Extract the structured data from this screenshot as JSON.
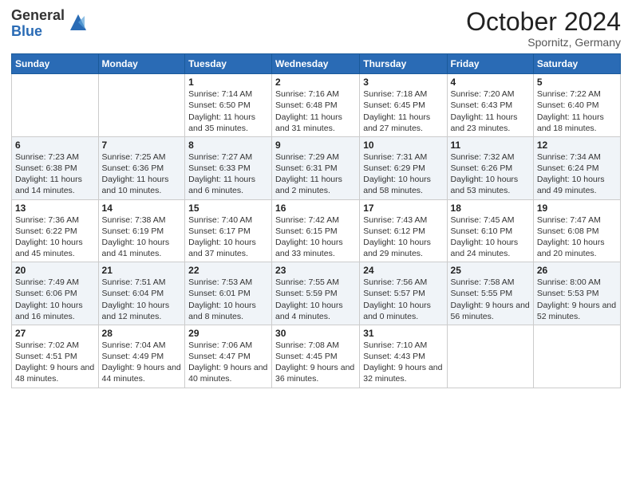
{
  "logo": {
    "general": "General",
    "blue": "Blue"
  },
  "header": {
    "month": "October 2024",
    "location": "Spornitz, Germany"
  },
  "weekdays": [
    "Sunday",
    "Monday",
    "Tuesday",
    "Wednesday",
    "Thursday",
    "Friday",
    "Saturday"
  ],
  "weeks": [
    [
      {
        "day": "",
        "info": ""
      },
      {
        "day": "",
        "info": ""
      },
      {
        "day": "1",
        "info": "Sunrise: 7:14 AM\nSunset: 6:50 PM\nDaylight: 11 hours and 35 minutes."
      },
      {
        "day": "2",
        "info": "Sunrise: 7:16 AM\nSunset: 6:48 PM\nDaylight: 11 hours and 31 minutes."
      },
      {
        "day": "3",
        "info": "Sunrise: 7:18 AM\nSunset: 6:45 PM\nDaylight: 11 hours and 27 minutes."
      },
      {
        "day": "4",
        "info": "Sunrise: 7:20 AM\nSunset: 6:43 PM\nDaylight: 11 hours and 23 minutes."
      },
      {
        "day": "5",
        "info": "Sunrise: 7:22 AM\nSunset: 6:40 PM\nDaylight: 11 hours and 18 minutes."
      }
    ],
    [
      {
        "day": "6",
        "info": "Sunrise: 7:23 AM\nSunset: 6:38 PM\nDaylight: 11 hours and 14 minutes."
      },
      {
        "day": "7",
        "info": "Sunrise: 7:25 AM\nSunset: 6:36 PM\nDaylight: 11 hours and 10 minutes."
      },
      {
        "day": "8",
        "info": "Sunrise: 7:27 AM\nSunset: 6:33 PM\nDaylight: 11 hours and 6 minutes."
      },
      {
        "day": "9",
        "info": "Sunrise: 7:29 AM\nSunset: 6:31 PM\nDaylight: 11 hours and 2 minutes."
      },
      {
        "day": "10",
        "info": "Sunrise: 7:31 AM\nSunset: 6:29 PM\nDaylight: 10 hours and 58 minutes."
      },
      {
        "day": "11",
        "info": "Sunrise: 7:32 AM\nSunset: 6:26 PM\nDaylight: 10 hours and 53 minutes."
      },
      {
        "day": "12",
        "info": "Sunrise: 7:34 AM\nSunset: 6:24 PM\nDaylight: 10 hours and 49 minutes."
      }
    ],
    [
      {
        "day": "13",
        "info": "Sunrise: 7:36 AM\nSunset: 6:22 PM\nDaylight: 10 hours and 45 minutes."
      },
      {
        "day": "14",
        "info": "Sunrise: 7:38 AM\nSunset: 6:19 PM\nDaylight: 10 hours and 41 minutes."
      },
      {
        "day": "15",
        "info": "Sunrise: 7:40 AM\nSunset: 6:17 PM\nDaylight: 10 hours and 37 minutes."
      },
      {
        "day": "16",
        "info": "Sunrise: 7:42 AM\nSunset: 6:15 PM\nDaylight: 10 hours and 33 minutes."
      },
      {
        "day": "17",
        "info": "Sunrise: 7:43 AM\nSunset: 6:12 PM\nDaylight: 10 hours and 29 minutes."
      },
      {
        "day": "18",
        "info": "Sunrise: 7:45 AM\nSunset: 6:10 PM\nDaylight: 10 hours and 24 minutes."
      },
      {
        "day": "19",
        "info": "Sunrise: 7:47 AM\nSunset: 6:08 PM\nDaylight: 10 hours and 20 minutes."
      }
    ],
    [
      {
        "day": "20",
        "info": "Sunrise: 7:49 AM\nSunset: 6:06 PM\nDaylight: 10 hours and 16 minutes."
      },
      {
        "day": "21",
        "info": "Sunrise: 7:51 AM\nSunset: 6:04 PM\nDaylight: 10 hours and 12 minutes."
      },
      {
        "day": "22",
        "info": "Sunrise: 7:53 AM\nSunset: 6:01 PM\nDaylight: 10 hours and 8 minutes."
      },
      {
        "day": "23",
        "info": "Sunrise: 7:55 AM\nSunset: 5:59 PM\nDaylight: 10 hours and 4 minutes."
      },
      {
        "day": "24",
        "info": "Sunrise: 7:56 AM\nSunset: 5:57 PM\nDaylight: 10 hours and 0 minutes."
      },
      {
        "day": "25",
        "info": "Sunrise: 7:58 AM\nSunset: 5:55 PM\nDaylight: 9 hours and 56 minutes."
      },
      {
        "day": "26",
        "info": "Sunrise: 8:00 AM\nSunset: 5:53 PM\nDaylight: 9 hours and 52 minutes."
      }
    ],
    [
      {
        "day": "27",
        "info": "Sunrise: 7:02 AM\nSunset: 4:51 PM\nDaylight: 9 hours and 48 minutes."
      },
      {
        "day": "28",
        "info": "Sunrise: 7:04 AM\nSunset: 4:49 PM\nDaylight: 9 hours and 44 minutes."
      },
      {
        "day": "29",
        "info": "Sunrise: 7:06 AM\nSunset: 4:47 PM\nDaylight: 9 hours and 40 minutes."
      },
      {
        "day": "30",
        "info": "Sunrise: 7:08 AM\nSunset: 4:45 PM\nDaylight: 9 hours and 36 minutes."
      },
      {
        "day": "31",
        "info": "Sunrise: 7:10 AM\nSunset: 4:43 PM\nDaylight: 9 hours and 32 minutes."
      },
      {
        "day": "",
        "info": ""
      },
      {
        "day": "",
        "info": ""
      }
    ]
  ]
}
